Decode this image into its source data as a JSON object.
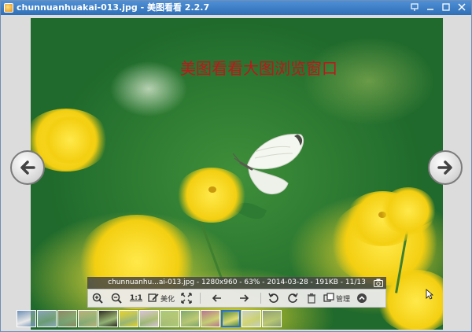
{
  "window": {
    "title": "chunnuanhuakai-013.jpg - 美图看看 2.2.7",
    "controls": [
      "pin-icon",
      "minimize-icon",
      "maximize-icon",
      "close-icon"
    ]
  },
  "image": {
    "watermark_text": "美图看看大图浏览窗口"
  },
  "info_bar": {
    "text": "chunnuanhu...ai-013.jpg - 1280x960 - 63% - 2014-03-28 - 191KB - 11/13"
  },
  "toolbar": {
    "zoom_in": "zoom-in-icon",
    "zoom_out": "zoom-out-icon",
    "actual_size_label": "1:1",
    "beautify_label": "美化",
    "fullscreen": "fullscreen-icon",
    "prev": "arrow-left-icon",
    "next": "arrow-right-icon",
    "rotate_left": "rotate-ccw-icon",
    "rotate_right": "rotate-cw-icon",
    "delete": "trash-icon",
    "manage_label": "管理",
    "collapse": "chevron-up-icon"
  },
  "colors": {
    "titlebar": "#3a7cc6",
    "watermark": "#c0161b",
    "selected_thumb_border": "#2a6ed8",
    "toolbar_bg": "#ebebeb",
    "info_bar_bg": "#464646"
  },
  "thumbnails": [
    {
      "color": "#6b8fb5"
    },
    {
      "color": "#8aa6b8"
    },
    {
      "color": "#8f8a62"
    },
    {
      "color": "#b9b07a"
    },
    {
      "color": "#2d2d20"
    },
    {
      "color": "#e6d22a"
    },
    {
      "color": "#d8c2d8"
    },
    {
      "color": "#aac878"
    },
    {
      "color": "#7fa86b"
    },
    {
      "color": "#b8748f"
    },
    {
      "color": "#5a8f45"
    },
    {
      "color": "#c8d0c0"
    },
    {
      "color": "#8f9f74"
    }
  ],
  "selected_thumbnail_index": 10
}
